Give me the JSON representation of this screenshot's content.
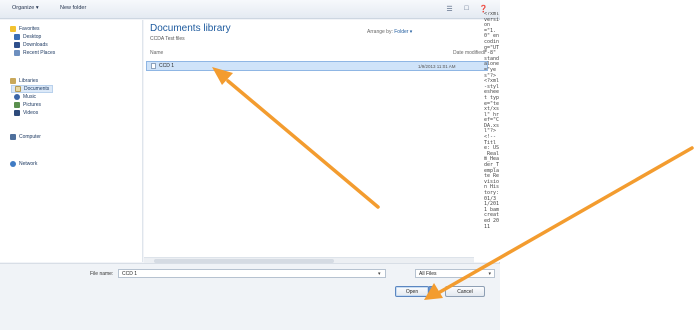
{
  "toolbar": {
    "organize_label": "Organize ▾",
    "new_folder_label": "New folder"
  },
  "nav": {
    "favorites": {
      "label": "Favorites",
      "items": [
        "Desktop",
        "Downloads",
        "Recent Places"
      ]
    },
    "libraries": {
      "label": "Libraries",
      "items": [
        "Documents",
        "Music",
        "Pictures",
        "Videos"
      ]
    },
    "computer_label": "Computer",
    "network_label": "Network"
  },
  "content": {
    "library_title": "Documents library",
    "library_subtitle": "CCDA Test files",
    "arrange_label": "Arrange by:",
    "arrange_value": "Folder ▾",
    "column_name": "Name",
    "column_date": "Date modified",
    "files": [
      {
        "name": "CCD 1",
        "date": "1/9/2013 11:01 AM"
      }
    ]
  },
  "xml_text": "<?xml version=\"1.0\" encoding=\"UTF-8\" standalone=\"yes\"?><?xml-stylesheet type=\"text/xsl\" href=\"CDA.xsl\"?><!-- Title: US_Realm_Header_Template Revision History: 01/31/2011 bam created 2011",
  "bottom": {
    "file_name_label": "File name:",
    "file_name_value": "CCD 1",
    "filter_value": "All Files",
    "open_label": "Open",
    "cancel_label": "Cancel"
  },
  "colors": {
    "arrow": "#f39c2f",
    "selection": "#cfe3f9",
    "title_blue": "#1d5a9e"
  }
}
